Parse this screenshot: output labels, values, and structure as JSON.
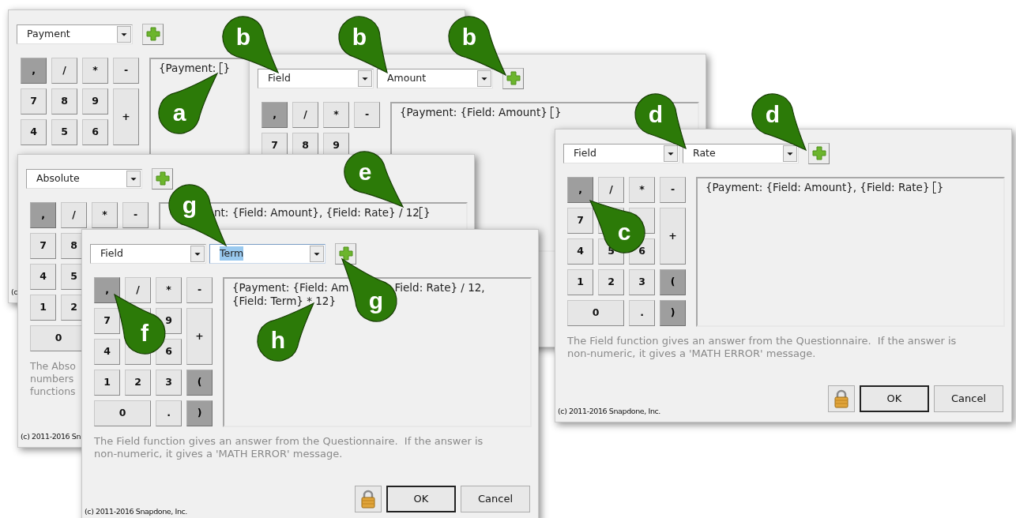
{
  "windows": [
    {
      "dropdowns": [
        {
          "value": "Payment",
          "text_selected": false
        }
      ],
      "key_rows": [
        [
          {
            "label": ",",
            "shaded": true
          },
          {
            "label": "/",
            "shaded": false
          },
          {
            "label": "*",
            "shaded": false
          },
          {
            "label": "-",
            "shaded": false
          }
        ],
        [
          {
            "label": "7",
            "shaded": false
          },
          {
            "label": "8",
            "shaded": false
          },
          {
            "label": "9",
            "shaded": false
          },
          {
            "label": "+",
            "shaded": false
          }
        ],
        [
          {
            "label": "4",
            "shaded": false
          },
          {
            "label": "5",
            "shaded": false
          },
          {
            "label": "6",
            "shaded": false
          }
        ]
      ],
      "formula": [
        [
          {
            "kind": "text",
            "text": "{Payment: "
          },
          {
            "kind": "cursor"
          },
          {
            "kind": "text",
            "text": "}"
          }
        ]
      ],
      "copyright": "(c"
    },
    {
      "dropdowns": [
        {
          "value": "Field",
          "text_selected": false
        },
        {
          "value": "Amount",
          "text_selected": false
        }
      ],
      "key_rows": [
        [
          {
            "label": ",",
            "shaded": true
          },
          {
            "label": "/",
            "shaded": false
          },
          {
            "label": "*",
            "shaded": false
          },
          {
            "label": "-",
            "shaded": false
          }
        ],
        [
          {
            "label": "7",
            "shaded": false
          },
          {
            "label": "8",
            "shaded": false
          },
          {
            "label": "9",
            "shaded": false
          }
        ]
      ],
      "formula": [
        [
          {
            "kind": "text",
            "text": "{Payment: {Field: Amount} "
          },
          {
            "kind": "cursor"
          },
          {
            "kind": "text",
            "text": "}"
          }
        ]
      ]
    },
    {
      "dropdowns": [
        {
          "value": "Absolute",
          "text_selected": false
        }
      ],
      "key_rows": [
        [
          {
            "label": ",",
            "shaded": true
          },
          {
            "label": "/",
            "shaded": false
          },
          {
            "label": "*",
            "shaded": false
          },
          {
            "label": "-",
            "shaded": false
          }
        ],
        [
          {
            "label": "7",
            "shaded": false
          },
          {
            "label": "8",
            "shaded": false
          }
        ],
        [
          {
            "label": "4",
            "shaded": false
          },
          {
            "label": "5",
            "shaded": false
          }
        ],
        [
          {
            "label": "1",
            "shaded": false
          },
          {
            "label": "2",
            "shaded": false
          }
        ],
        [
          {
            "label": "0",
            "shaded": false
          }
        ]
      ],
      "formula": [
        [
          {
            "kind": "covered"
          },
          {
            "kind": "text",
            "text": "nt: {Field: Amount}, {Field: Rate} / 12"
          },
          {
            "kind": "cursor"
          },
          {
            "kind": "text",
            "text": "}"
          }
        ]
      ],
      "description_lines": [
        "The Abso",
        "numbers",
        "functions"
      ],
      "copyright": "(c) 2011-2016 Sn"
    },
    {
      "dropdowns": [
        {
          "value": "Field",
          "text_selected": false
        },
        {
          "value": "Term",
          "text_selected": true
        }
      ],
      "key_rows": [
        [
          {
            "label": ",",
            "shaded": true
          },
          {
            "label": "/",
            "shaded": false
          },
          {
            "label": "*",
            "shaded": false
          },
          {
            "label": "-",
            "shaded": false
          }
        ],
        [
          {
            "label": "7",
            "shaded": false
          },
          {
            "shaded": false
          },
          {
            "label": "9",
            "shaded": false
          },
          {
            "label": "+",
            "shaded": false
          }
        ],
        [
          {
            "label": "4",
            "shaded": false
          },
          {
            "shaded": false
          },
          {
            "label": "6",
            "shaded": false
          }
        ],
        [
          {
            "label": "1",
            "shaded": false
          },
          {
            "label": "2",
            "shaded": false
          },
          {
            "label": "3",
            "shaded": false
          },
          {
            "label": "(",
            "shaded": true
          }
        ],
        [
          {
            "label": "0",
            "shaded": false
          },
          {
            "label": ".",
            "shaded": false
          },
          {
            "label": ")",
            "shaded": true
          }
        ]
      ],
      "formula": [
        [
          {
            "kind": "text",
            "text": "{Payment: {Field: Am"
          },
          {
            "kind": "covered"
          },
          {
            "kind": "text",
            "text": "Field: Rate} / 12,"
          }
        ],
        [
          {
            "kind": "text",
            "text": "{Field: Term} * 12}"
          }
        ]
      ],
      "description": "The Field function gives an answer from the Questionnaire.  If the answer is non-numeric, it gives a 'MATH ERROR' message.",
      "buttons": [
        {
          "kind": "lock"
        },
        {
          "kind": "default",
          "label": "OK"
        },
        {
          "kind": "plain",
          "label": "Cancel"
        }
      ],
      "copyright": "(c) 2011-2016 Snapdone, Inc."
    },
    {
      "dropdowns": [
        {
          "value": "Field",
          "text_selected": false
        },
        {
          "value": "Rate",
          "text_selected": false
        }
      ],
      "key_rows": [
        [
          {
            "label": ",",
            "shaded": true
          },
          {
            "label": "/",
            "shaded": false
          },
          {
            "label": "*",
            "shaded": false
          },
          {
            "label": "-",
            "shaded": false
          }
        ],
        [
          {
            "label": "7",
            "shaded": false
          },
          {
            "shaded": false
          },
          {
            "shaded": false
          },
          {
            "label": "+",
            "shaded": false
          }
        ],
        [
          {
            "label": "4",
            "shaded": false
          },
          {
            "label": "5",
            "shaded": false
          },
          {
            "label": "6",
            "shaded": false
          }
        ],
        [
          {
            "label": "1",
            "shaded": false
          },
          {
            "label": "2",
            "shaded": false
          },
          {
            "label": "3",
            "shaded": false
          },
          {
            "label": "(",
            "shaded": true
          }
        ],
        [
          {
            "label": "0",
            "shaded": false
          },
          {
            "label": ".",
            "shaded": false
          },
          {
            "label": ")",
            "shaded": true
          }
        ]
      ],
      "formula": [
        [
          {
            "kind": "text",
            "text": "{Payment: {Field: Amount}, {Field: Rate} "
          },
          {
            "kind": "cursor"
          },
          {
            "kind": "text",
            "text": "}"
          }
        ]
      ],
      "description": "The Field function gives an answer from the Questionnaire.  If the answer is non-numeric, it gives a 'MATH ERROR' message.",
      "buttons": [
        {
          "kind": "lock"
        },
        {
          "kind": "default",
          "label": "OK"
        },
        {
          "kind": "plain",
          "label": "Cancel"
        }
      ],
      "copyright": "(c) 2011-2016 Snapdone, Inc."
    }
  ],
  "callouts": [
    {
      "label": "b"
    },
    {
      "label": "b"
    },
    {
      "label": "b"
    },
    {
      "label": "a"
    },
    {
      "label": "d"
    },
    {
      "label": "d"
    },
    {
      "label": "e"
    },
    {
      "label": "g"
    },
    {
      "label": "c"
    },
    {
      "label": "g"
    },
    {
      "label": "f"
    },
    {
      "label": "h"
    }
  ]
}
